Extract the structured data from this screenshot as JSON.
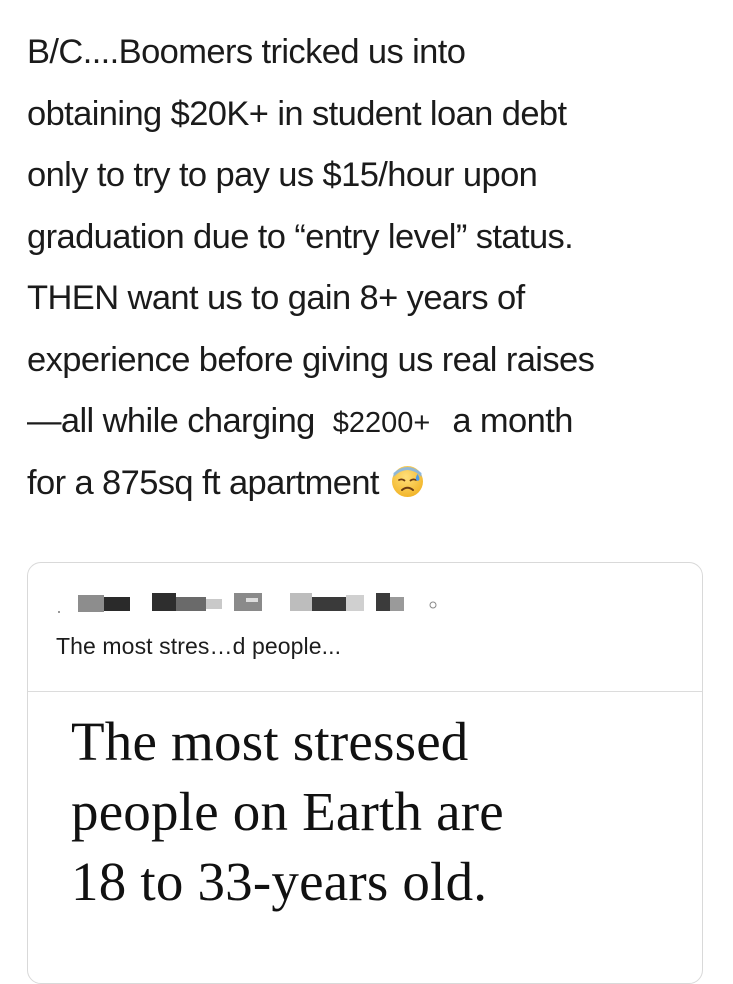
{
  "post": {
    "lines": [
      "B/C....Boomers tricked us into",
      "obtaining $20K+ in student loan debt",
      "only to try to pay us $15/hour upon",
      "graduation due to “entry level” status.",
      "THEN want us to gain 8+ years of",
      "experience before giving us real raises"
    ],
    "line7_start": "—all while charging",
    "line7_price": "$2200+",
    "line7_end": "a month",
    "line8": "for a 875sq ft apartment",
    "emoji": "anxious-face-with-sweat-icon"
  },
  "card": {
    "source_redacted": true,
    "headline_snippet": "The most stres…d people...",
    "image_headline_lines": [
      "The most stressed",
      "people on Earth are",
      "18 to 33-years old."
    ]
  },
  "colors": {
    "text": "#1b1b1b",
    "card_border": "#d9d9d9",
    "emoji_face": "#f6c33b",
    "emoji_sweat": "#5aa0e6"
  }
}
